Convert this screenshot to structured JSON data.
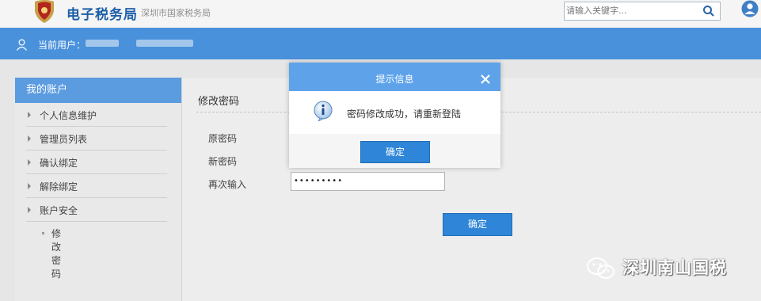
{
  "header": {
    "site_title": "电子税务局",
    "site_subtitle": "深圳市国家税务局",
    "search_placeholder": "请输入关键字...",
    "search_icon": "search-icon",
    "user_icon": "user-circle-icon"
  },
  "userbar": {
    "current_user_label": "当前用户："
  },
  "sidebar": {
    "heading": "我的账户",
    "items": [
      {
        "label": "个人信息维护"
      },
      {
        "label": "管理员列表"
      },
      {
        "label": "确认绑定"
      },
      {
        "label": "解除绑定"
      },
      {
        "label": "账户安全"
      }
    ],
    "sub_item": "修改密码"
  },
  "main": {
    "title": "修改密码",
    "labels": {
      "old_password": "原密码",
      "new_password": "新密码",
      "repeat_password": "再次输入"
    },
    "repeat_value": "•••••••••",
    "confirm_label": "确定"
  },
  "modal": {
    "title": "提示信息",
    "message": "密码修改成功，请重新登陆",
    "ok_label": "确定",
    "icon": "info-icon",
    "close_icon": "close-icon"
  },
  "watermark": {
    "text": "深圳南山国税"
  },
  "colors": {
    "brand_blue": "#4a91dc",
    "button_blue": "#2f86d8",
    "modal_header": "#5ea3ea"
  }
}
